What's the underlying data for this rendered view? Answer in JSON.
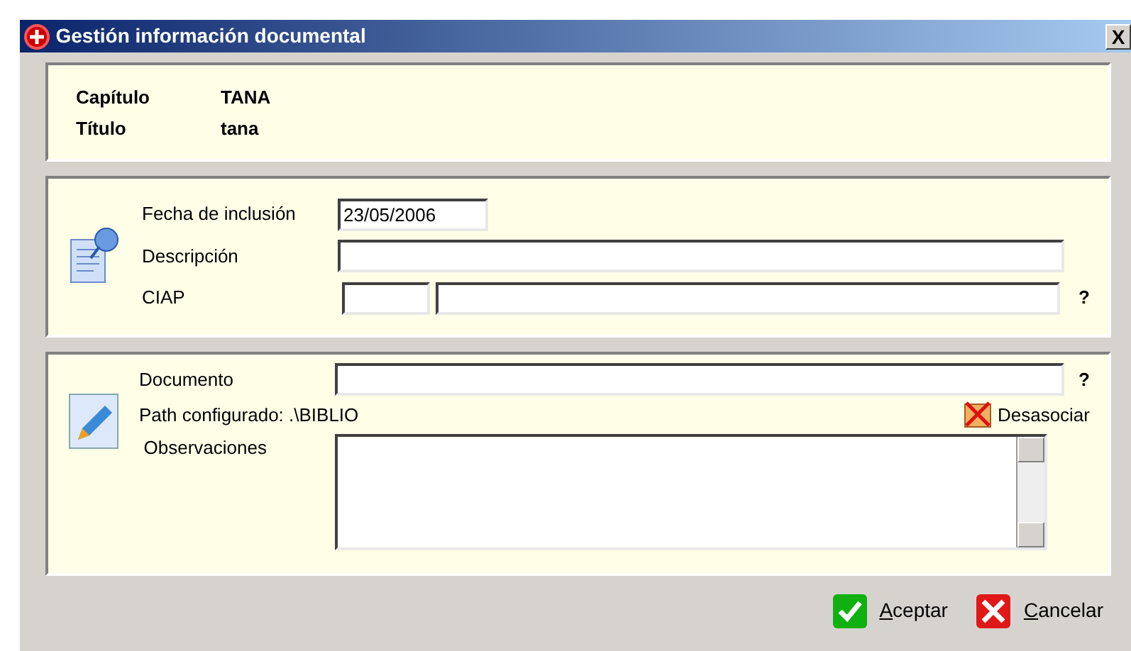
{
  "window": {
    "title": "Gestión información documental",
    "close": "X"
  },
  "header": [
    {
      "label": "Capítulo",
      "value": "TANA"
    },
    {
      "label": "Título",
      "value": "tana"
    }
  ],
  "general": {
    "fecha": {
      "label": "Fecha de inclusión",
      "value": "23/05/2006"
    },
    "descripcion": {
      "label": "Descripción"
    },
    "ciap": {
      "label": "CIAP",
      "help": "?"
    }
  },
  "documento": {
    "label": "Documento",
    "help": "?",
    "path": "Path configurado: .\\BIBLIO",
    "unlink": "Desasociar",
    "observaciones": "Observaciones"
  },
  "buttons": [
    {
      "kind": "ok",
      "label": "Aceptar"
    },
    {
      "kind": "cancel",
      "label": "Cancelar"
    }
  ]
}
